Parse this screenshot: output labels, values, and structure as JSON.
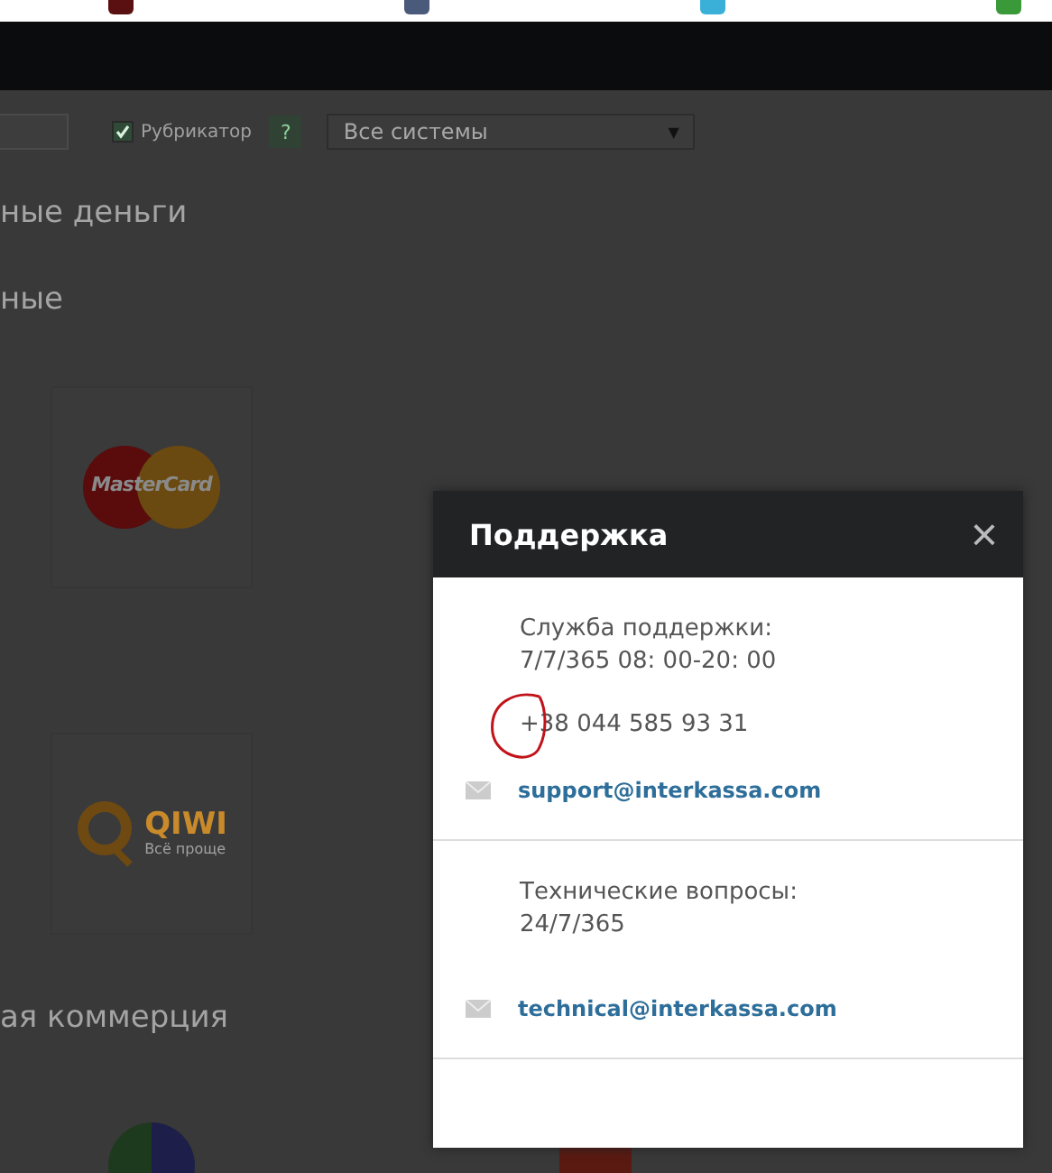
{
  "filters": {
    "rubricator": {
      "label": "Рубрикатор",
      "checked": true,
      "help": "?"
    },
    "system_select": {
      "value": "Все системы",
      "arrow": "▼"
    }
  },
  "sections": [
    {
      "heading": "ные деньги"
    },
    {
      "heading": "ные",
      "logos": [
        {
          "kind": "mastercard",
          "text": "MasterCard"
        },
        {
          "kind": "qiwi",
          "text": "QIWI",
          "subtext": "Всё проще"
        }
      ]
    },
    {
      "heading": "ая коммерция"
    }
  ],
  "modal": {
    "title": "Поддержка",
    "close": "×",
    "blocks": [
      {
        "lines": [
          "Служба поддержки:",
          "7/7/365 08: 00-20: 00"
        ],
        "phone": "+38 044 585 93 31",
        "email": "support@interkassa.com"
      },
      {
        "lines": [
          "Технические вопросы:",
          "24/7/365"
        ],
        "email": "technical@interkassa.com"
      }
    ]
  }
}
